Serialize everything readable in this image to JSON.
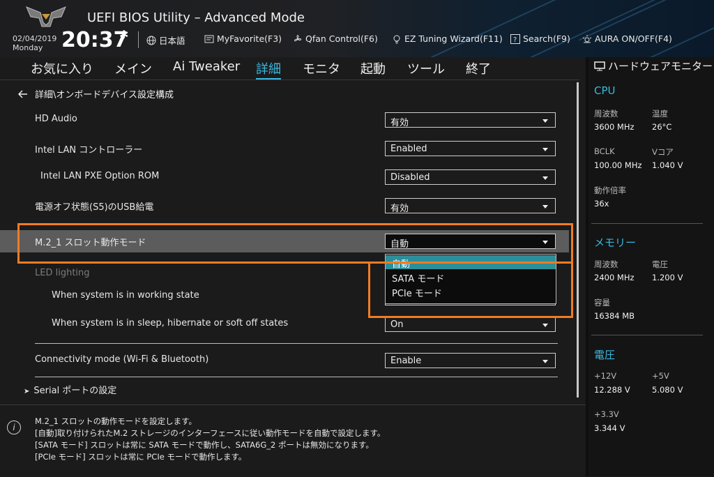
{
  "header": {
    "app_title": "UEFI BIOS Utility – Advanced Mode",
    "date": "02/04/2019",
    "day": "Monday",
    "time": "20:37",
    "buttons": [
      {
        "label": "日本語",
        "icon": "globe-icon"
      },
      {
        "label": "MyFavorite(F3)",
        "icon": "favorite-list-icon"
      },
      {
        "label": "Qfan Control(F6)",
        "icon": "fan-icon"
      },
      {
        "label": "EZ Tuning Wizard(F11)",
        "icon": "lightbulb-icon"
      },
      {
        "label": "Search(F9)",
        "icon": "search-box-icon"
      },
      {
        "label": "AURA ON/OFF(F4)",
        "icon": "aura-light-icon"
      }
    ]
  },
  "tabs": [
    {
      "label": "お気に入り"
    },
    {
      "label": "メイン"
    },
    {
      "label": "Ai Tweaker"
    },
    {
      "label": "詳細",
      "active": true
    },
    {
      "label": "モニタ"
    },
    {
      "label": "起動"
    },
    {
      "label": "ツール"
    },
    {
      "label": "終了"
    }
  ],
  "breadcrumb": "詳細\\オンボードデバイス設定構成",
  "settings": [
    {
      "label": "HD Audio",
      "value": "有効"
    },
    {
      "label": "Intel LAN コントローラー",
      "value": "Enabled"
    },
    {
      "label": "Intel LAN PXE Option ROM",
      "value": "Disabled"
    },
    {
      "label": "電源オフ状態(S5)のUSB給電",
      "value": "有効"
    },
    {
      "label": "M.2_1 スロット動作モード",
      "value": "自動"
    },
    {
      "label": "LED lighting"
    },
    {
      "label": "When system is in working state"
    },
    {
      "label": "When system is in sleep, hibernate or soft off states",
      "value": "On"
    },
    {
      "label": "Connectivity mode (Wi-Fi & Bluetooth)",
      "value": "Enable"
    },
    {
      "label": "Serial ポートの設定"
    }
  ],
  "dropdown_options": [
    "自動",
    "SATA モード",
    "PCIe モード"
  ],
  "info_lines": [
    "M.2_1 スロットの動作モードを設定します。",
    "[自動]取り付けられたM.2 ストレージのインターフェースに従い動作モードを自動で設定します。",
    "[SATA モード] スロットは常に SATA モードで動作し、SATA6G_2 ポートは無効になります。",
    "[PCIe モード] スロットは常に PCIe モードで動作します。"
  ],
  "hardware_monitor": {
    "title": "ハードウェアモニター",
    "cpu": {
      "heading": "CPU",
      "freq_label": "周波数",
      "freq": "3600 MHz",
      "temp_label": "温度",
      "temp": "26°C",
      "bclk_label": "BCLK",
      "bclk": "100.00 MHz",
      "vcore_label": "Vコア",
      "vcore": "1.040 V",
      "ratio_label": "動作倍率",
      "ratio": "36x"
    },
    "memory": {
      "heading": "メモリー",
      "freq_label": "周波数",
      "freq": "2400 MHz",
      "volt_label": "電圧",
      "volt": "1.200 V",
      "cap_label": "容量",
      "cap": "16384 MB"
    },
    "voltage": {
      "heading": "電圧",
      "v12_label": "+12V",
      "v12": "12.288 V",
      "v5_label": "+5V",
      "v5": "5.080 V",
      "v33_label": "+3.3V",
      "v33": "3.344 V"
    }
  },
  "colors": {
    "accent": "#3ab8e0",
    "highlight_box": "#f07c24",
    "selected_option": "#2c8e98",
    "selected_row": "#5c5c5c"
  }
}
